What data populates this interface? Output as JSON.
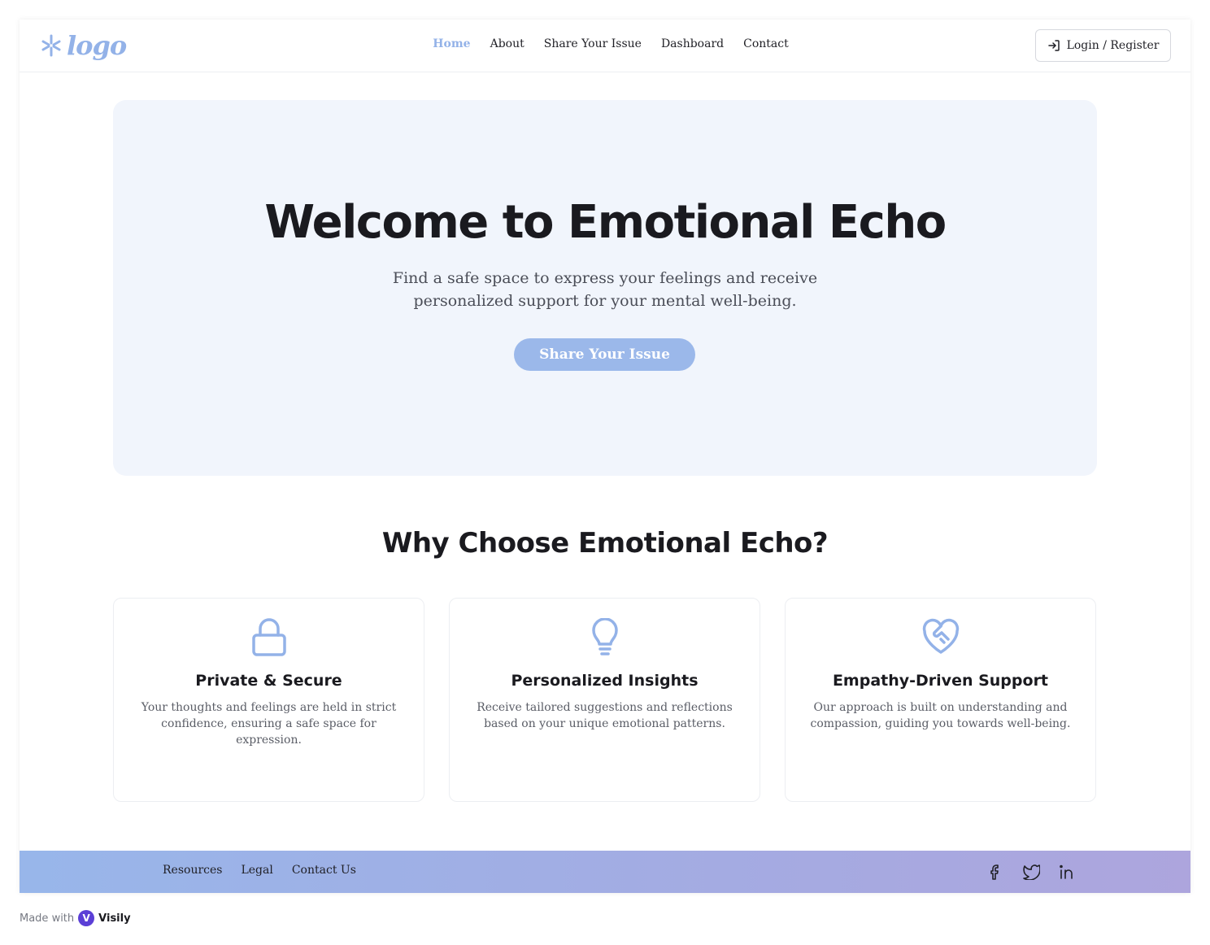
{
  "header": {
    "logo_text": "logo",
    "nav": [
      {
        "label": "Home",
        "active": true
      },
      {
        "label": "About"
      },
      {
        "label": "Share Your Issue"
      },
      {
        "label": "Dashboard"
      },
      {
        "label": "Contact"
      }
    ],
    "login_label": "Login / Register"
  },
  "hero": {
    "title": "Welcome to Emotional Echo",
    "subtitle": "Find a safe space to express your feelings and receive personalized support for your mental well-being.",
    "cta_label": "Share Your Issue"
  },
  "features": {
    "title": "Why Choose Emotional Echo?",
    "cards": [
      {
        "icon": "lock-icon",
        "title": "Private & Secure",
        "description": "Your thoughts and feelings are held in strict confidence, ensuring a safe space for expression."
      },
      {
        "icon": "lightbulb-icon",
        "title": "Personalized Insights",
        "description": "Receive tailored suggestions and reflections based on your unique emotional patterns."
      },
      {
        "icon": "heart-handshake-icon",
        "title": "Empathy-Driven Support",
        "description": "Our approach is built on understanding and compassion, guiding you towards well-being."
      }
    ]
  },
  "footer": {
    "links": [
      "Resources",
      "Legal",
      "Contact Us"
    ],
    "social": [
      "facebook-icon",
      "twitter-icon",
      "linkedin-icon"
    ]
  },
  "made_with": {
    "prefix": "Made with",
    "brand": "Visily"
  },
  "colors": {
    "accent": "#93b2e8",
    "hero_bg": "#f1f5fc",
    "cta_bg": "#9bb8ea",
    "footer_gradient_start": "#98b6ea",
    "footer_gradient_end": "#ada5dd"
  }
}
